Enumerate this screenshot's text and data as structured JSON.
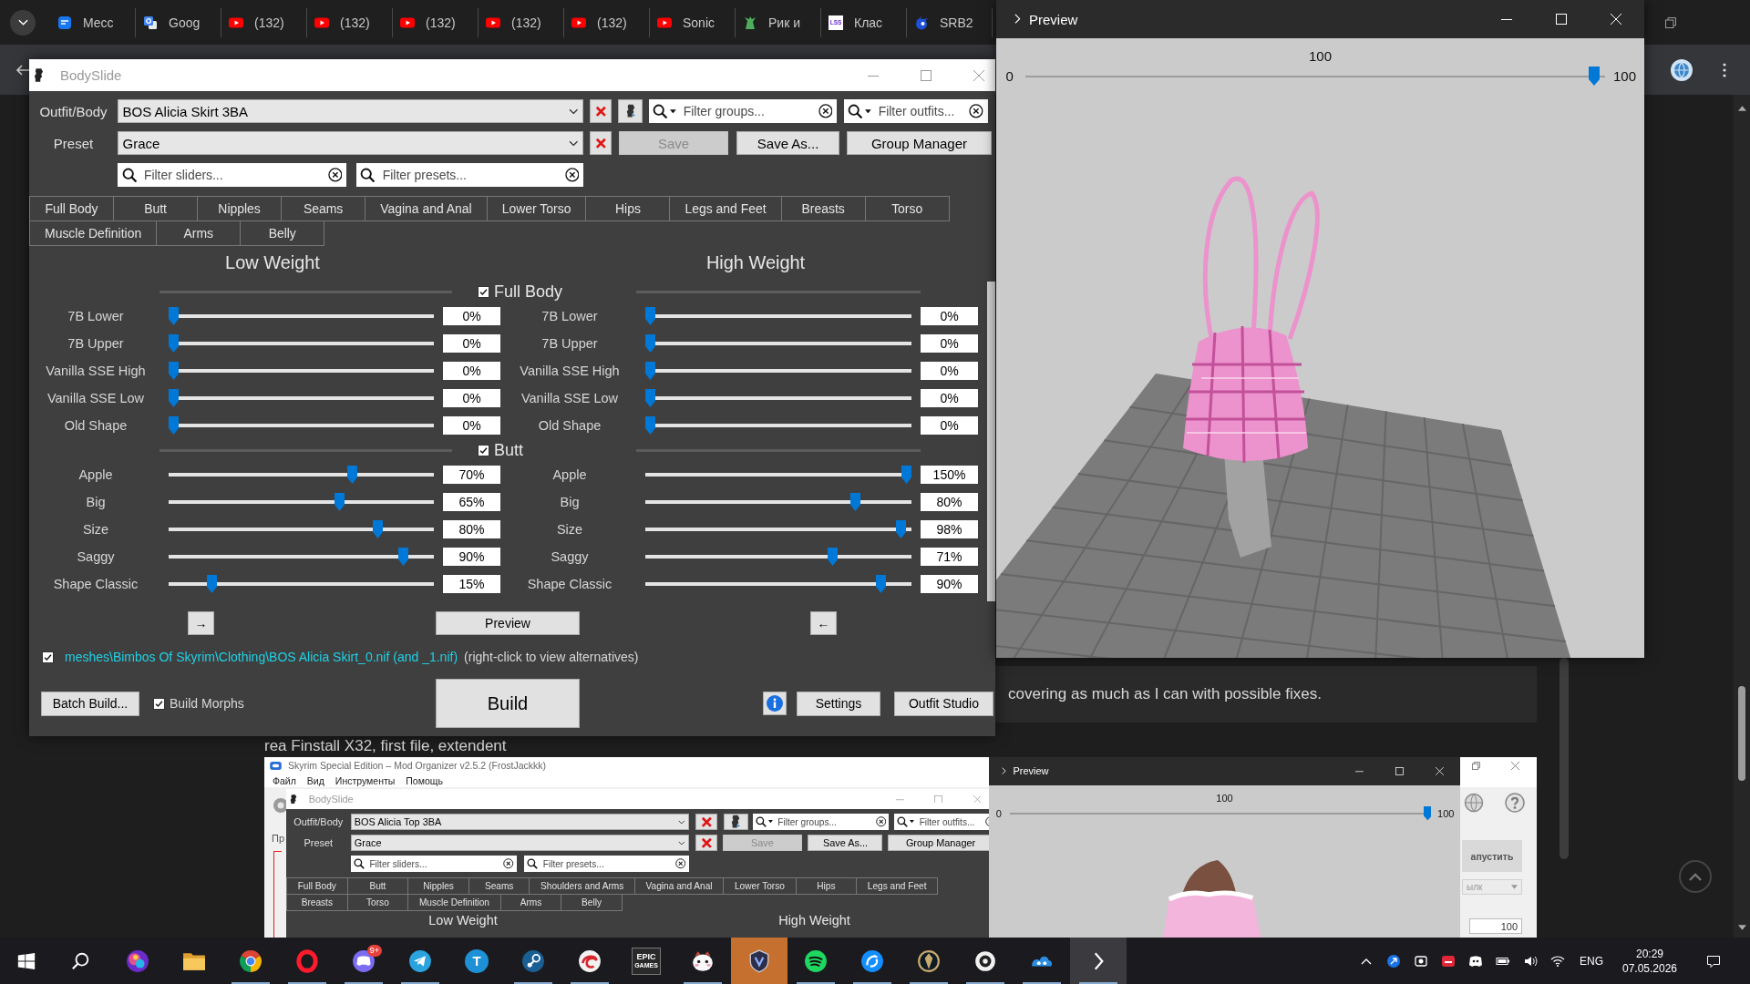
{
  "browser": {
    "tabs": [
      {
        "kind": "messenger",
        "label": "Месс"
      },
      {
        "kind": "translate",
        "label": "Goog"
      },
      {
        "kind": "youtube",
        "label": "(132)"
      },
      {
        "kind": "youtube",
        "label": "(132)"
      },
      {
        "kind": "youtube",
        "label": "(132)"
      },
      {
        "kind": "youtube",
        "label": "(132)"
      },
      {
        "kind": "youtube",
        "label": "(132)"
      },
      {
        "kind": "youtube",
        "label": "Sonic"
      },
      {
        "kind": "character",
        "label": "Рик и"
      },
      {
        "kind": "tile",
        "label": "Клас",
        "icon_text": "LSS"
      },
      {
        "kind": "hedgehog",
        "label": "SRB2"
      }
    ],
    "page": {
      "post_text": "covering as much as I can with possible fixes.",
      "cut_text": "rea Finstall X32, first file, extendent",
      "screenshot": {
        "title": "Skyrim Special Edition – Mod Organizer v2.5.2 (FrostJackkk)",
        "menu": [
          "Файл",
          "Вид",
          "Инструменты",
          "Помощь"
        ],
        "side_text": "Пр",
        "run_button": "апустить",
        "dropdown_value": "ылк",
        "count_value": "100",
        "bodyslide": {
          "title": "BodySlide",
          "outfit": {
            "label": "Outfit/Body",
            "value": "BOS Alicia Top 3BA"
          },
          "preset": {
            "label": "Preset",
            "value": "Grace"
          },
          "filter_groups": {
            "placeholder": "Filter groups..."
          },
          "filter_outfits": {
            "placeholder": "Filter outfits..."
          },
          "buttons": [
            {
              "label": "Save",
              "disabled": true
            },
            {
              "label": "Save As...",
              "disabled": false
            },
            {
              "label": "Group Manager",
              "disabled": false
            }
          ],
          "filter_sliders": {
            "placeholder": "Filter sliders..."
          },
          "filter_presets": {
            "placeholder": "Filter presets..."
          },
          "tab_rows": [
            [
              "Full Body",
              "Butt",
              "Nipples",
              "Seams",
              "Shoulders and Arms",
              "Vagina and Anal",
              "Lower Torso",
              "Hips",
              "Legs and Feet"
            ],
            [
              "Breasts",
              "Torso",
              "Muscle Definition",
              "Arms",
              "Belly"
            ]
          ],
          "low_weight": "Low Weight",
          "high_weight": "High Weight"
        },
        "preview": {
          "title": "Preview",
          "caption": "100",
          "min": "0",
          "max": "100",
          "level": 1
        }
      }
    }
  },
  "bodyslide": {
    "title": "BodySlide",
    "outfit": {
      "label": "Outfit/Body",
      "value": "BOS Alicia Skirt 3BA"
    },
    "preset": {
      "label": "Preset",
      "value": "Grace"
    },
    "filter_groups": {
      "placeholder": "Filter groups..."
    },
    "filter_outfits": {
      "placeholder": "Filter outfits..."
    },
    "buttons": [
      {
        "label": "Save",
        "disabled": true
      },
      {
        "label": "Save As...",
        "disabled": false
      },
      {
        "label": "Group Manager",
        "disabled": false
      }
    ],
    "filter_sliders": {
      "placeholder": "Filter sliders..."
    },
    "filter_presets": {
      "placeholder": "Filter presets..."
    },
    "tab_rows": [
      [
        "Full Body",
        "Butt",
        "Nipples",
        "Seams",
        "Vagina and Anal",
        "Lower Torso",
        "Hips",
        "Legs and Feet",
        "Breasts",
        "Torso"
      ],
      [
        "Muscle Definition",
        "Arms",
        "Belly"
      ]
    ],
    "low_weight": "Low Weight",
    "high_weight": "High Weight",
    "groups": [
      {
        "name": "Full Body",
        "checked": true,
        "sliders": [
          {
            "low": {
              "label": "7B Lower",
              "value": "0%",
              "level": 0
            },
            "high": {
              "label": "7B Lower",
              "value": "0%",
              "level": 0
            }
          },
          {
            "low": {
              "label": "7B Upper",
              "value": "0%",
              "level": 0
            },
            "high": {
              "label": "7B Upper",
              "value": "0%",
              "level": 0
            }
          },
          {
            "low": {
              "label": "Vanilla SSE High",
              "value": "0%",
              "level": 0
            },
            "high": {
              "label": "Vanilla SSE High",
              "value": "0%",
              "level": 0
            }
          },
          {
            "low": {
              "label": "Vanilla SSE Low",
              "value": "0%",
              "level": 0
            },
            "high": {
              "label": "Vanilla SSE Low",
              "value": "0%",
              "level": 0
            }
          },
          {
            "low": {
              "label": "Old Shape",
              "value": "0%",
              "level": 0
            },
            "high": {
              "label": "Old Shape",
              "value": "0%",
              "level": 0
            }
          }
        ]
      },
      {
        "name": "Butt",
        "checked": true,
        "sliders": [
          {
            "low": {
              "label": "Apple",
              "value": "70%",
              "level": 0.7
            },
            "high": {
              "label": "Apple",
              "value": "150%",
              "level": 1
            }
          },
          {
            "low": {
              "label": "Big",
              "value": "65%",
              "level": 0.65
            },
            "high": {
              "label": "Big",
              "value": "80%",
              "level": 0.8
            }
          },
          {
            "low": {
              "label": "Size",
              "value": "80%",
              "level": 0.8
            },
            "high": {
              "label": "Size",
              "value": "98%",
              "level": 0.98
            }
          },
          {
            "low": {
              "label": "Saggy",
              "value": "90%",
              "level": 0.9
            },
            "high": {
              "label": "Saggy",
              "value": "71%",
              "level": 0.71
            }
          },
          {
            "low": {
              "label": "Shape Classic",
              "value": "15%",
              "level": 0.15
            },
            "high": {
              "label": "Shape Classic",
              "value": "90%",
              "level": 0.9
            }
          }
        ]
      }
    ],
    "nav": {
      "left": "→",
      "center": "Preview",
      "right": "←"
    },
    "output": {
      "checked": true,
      "path": "meshes\\Bimbos Of Skyrim\\Clothing\\BOS Alicia Skirt_0.nif (and _1.nif)",
      "hint": "(right-click to view alternatives)"
    },
    "batch_build": "Batch Build...",
    "build_morphs": {
      "label": "Build Morphs",
      "checked": true
    },
    "build": "Build",
    "settings": "Settings",
    "outfit_studio": "Outfit Studio"
  },
  "preview": {
    "title": "Preview",
    "caption": "100",
    "min": "0",
    "max": "100",
    "level": 0.99
  },
  "taskbar": {
    "apps": [
      {
        "kind": "orb",
        "running": false,
        "flashing": false,
        "selected": false
      },
      {
        "kind": "folder",
        "running": false,
        "flashing": false,
        "selected": false
      },
      {
        "kind": "chrome",
        "running": true,
        "flashing": false,
        "selected": false
      },
      {
        "kind": "opera",
        "running": true,
        "flashing": false,
        "selected": false
      },
      {
        "kind": "chat",
        "running": true,
        "flashing": false,
        "selected": false,
        "badge": "9+"
      },
      {
        "kind": "telegram",
        "running": true,
        "flashing": false,
        "selected": false
      },
      {
        "kind": "letter",
        "running": false,
        "flashing": false,
        "selected": false,
        "text": "T"
      },
      {
        "kind": "steam",
        "running": true,
        "flashing": false,
        "selected": false
      },
      {
        "kind": "swirl",
        "running": true,
        "flashing": false,
        "selected": false
      },
      {
        "kind": "epic",
        "running": false,
        "flashing": false,
        "selected": false,
        "text": "EPIC",
        "subtext": "GAMES"
      },
      {
        "kind": "mascot",
        "running": true,
        "flashing": false,
        "selected": false
      },
      {
        "kind": "shield",
        "running": false,
        "flashing": true,
        "selected": false
      },
      {
        "kind": "spotify",
        "running": true,
        "flashing": false,
        "selected": false
      },
      {
        "kind": "battlenet",
        "running": true,
        "flashing": false,
        "selected": false
      },
      {
        "kind": "emblem",
        "running": true,
        "flashing": false,
        "selected": false
      },
      {
        "kind": "eye",
        "running": true,
        "flashing": false,
        "selected": false
      },
      {
        "kind": "cloud",
        "running": true,
        "flashing": false,
        "selected": false
      },
      {
        "kind": "chevron",
        "running": true,
        "flashing": false,
        "selected": true
      }
    ],
    "language": "ENG",
    "time": "20:29",
    "date": "07.05.2026"
  }
}
